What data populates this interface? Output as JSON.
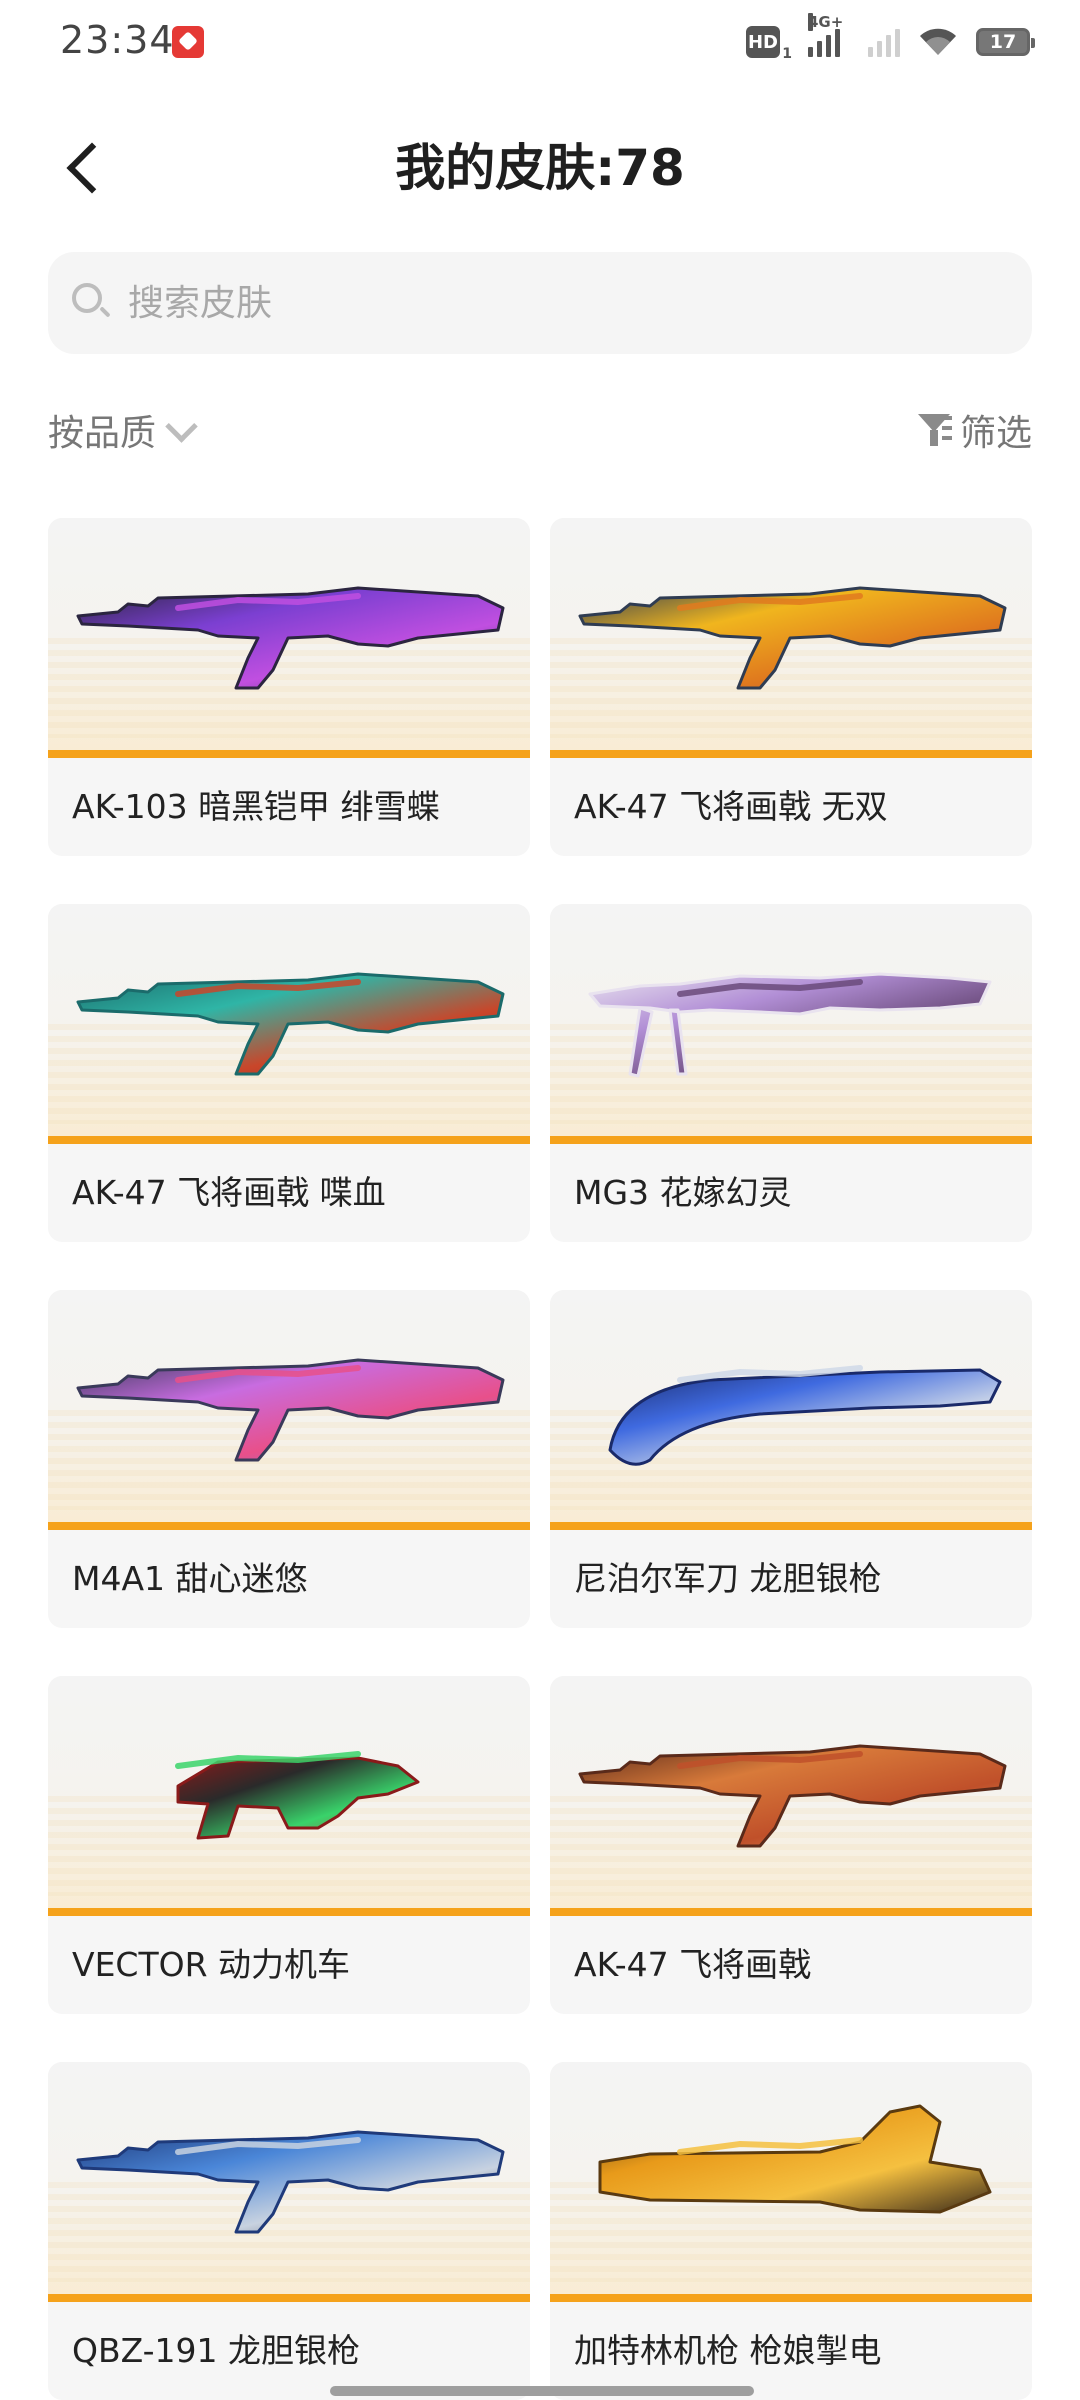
{
  "status_bar": {
    "time": "23:34",
    "hd_label": "HD",
    "hd_sub": "1",
    "network_label": "4G+",
    "battery": "17"
  },
  "header": {
    "title": "我的皮肤:78"
  },
  "search": {
    "placeholder": "搜索皮肤",
    "value": ""
  },
  "toolbar": {
    "sort_label": "按品质",
    "filter_label": "筛选"
  },
  "colors": {
    "accent": "#f5a21b",
    "card_bg": "#f6f6f6"
  },
  "skins": [
    {
      "name": "AK-103 暗黑铠甲 绯雪蝶",
      "palette": [
        "#2b2540",
        "#7b3fd1",
        "#c04fe0",
        "#3a2f6a"
      ]
    },
    {
      "name": "AK-47 飞将画戟 无双",
      "palette": [
        "#2f3c52",
        "#f0b51e",
        "#e07a1e",
        "#b8442a"
      ]
    },
    {
      "name": "AK-47 飞将画戟 喋血",
      "palette": [
        "#1b6b6b",
        "#2fb5a6",
        "#c9462a",
        "#8e2a2a"
      ]
    },
    {
      "name": "MG3 花嫁幻灵",
      "palette": [
        "#e9e3ef",
        "#b28fd6",
        "#6a4a7a",
        "#d9c2a8"
      ]
    },
    {
      "name": "M4A1 甜心迷悠",
      "palette": [
        "#3a3a5a",
        "#c86ce0",
        "#e8508a",
        "#5a7ae8"
      ]
    },
    {
      "name": "尼泊尔军刀 龙胆银枪",
      "palette": [
        "#1a2a6a",
        "#3f6ae0",
        "#cfd8e8",
        "#444"
      ]
    },
    {
      "name": "VECTOR 动力机车",
      "palette": [
        "#8a1a1a",
        "#2a2a2a",
        "#39d36a",
        "#c43a3a"
      ]
    },
    {
      "name": "AK-47 飞将画戟",
      "palette": [
        "#5a2a1a",
        "#d87a3a",
        "#c0502a",
        "#e0a060"
      ]
    },
    {
      "name": "QBZ-191 龙胆银枪",
      "palette": [
        "#1f3a7a",
        "#4a86d8",
        "#c8d2e0",
        "#2a2a3a"
      ]
    },
    {
      "name": "加特林机枪 枪娘掣电",
      "palette": [
        "#5a3a10",
        "#e89a1a",
        "#f5c040",
        "#3a2a1a"
      ]
    }
  ]
}
